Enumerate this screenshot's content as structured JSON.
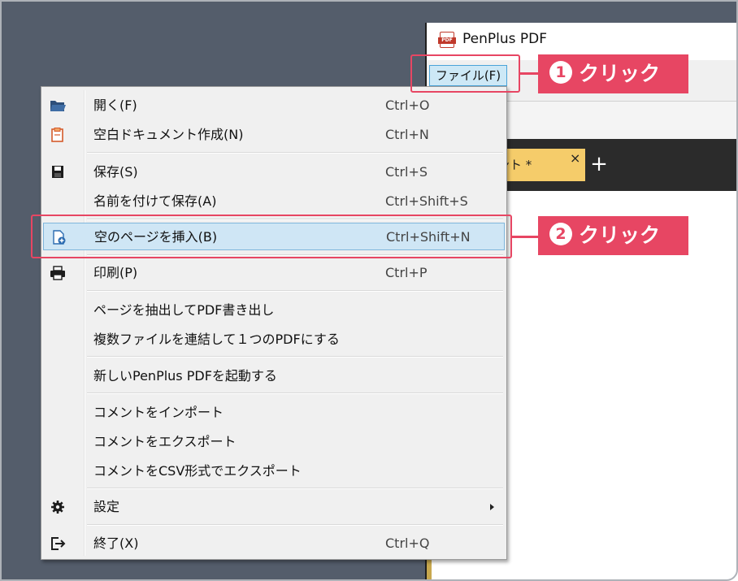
{
  "window": {
    "title": "PenPlus PDF",
    "icon": "pdf-app-icon",
    "icon_text": "PDF"
  },
  "menubar": {
    "file_label": "ファイル(F)"
  },
  "tabs": [
    {
      "label": "メント *",
      "close": "×"
    }
  ],
  "tab_add": "+",
  "file_menu": {
    "items": [
      {
        "icon": "folder-open-icon",
        "label": "開く(F)",
        "shortcut": "Ctrl+O"
      },
      {
        "icon": "new-document-icon",
        "label": "空白ドキュメント作成(N)",
        "shortcut": "Ctrl+N"
      },
      {
        "icon": "save-icon",
        "label": "保存(S)",
        "shortcut": "Ctrl+S"
      },
      {
        "icon": "",
        "label": "名前を付けて保存(A)",
        "shortcut": "Ctrl+Shift+S"
      },
      {
        "icon": "insert-page-icon",
        "label": "空のページを挿入(B)",
        "shortcut": "Ctrl+Shift+N"
      },
      {
        "icon": "printer-icon",
        "label": "印刷(P)",
        "shortcut": "Ctrl+P"
      },
      {
        "icon": "",
        "label": "ページを抽出してPDF書き出し",
        "shortcut": ""
      },
      {
        "icon": "",
        "label": "複数ファイルを連結して１つのPDFにする",
        "shortcut": ""
      },
      {
        "icon": "",
        "label": "新しいPenPlus PDFを起動する",
        "shortcut": ""
      },
      {
        "icon": "",
        "label": "コメントをインポート",
        "shortcut": ""
      },
      {
        "icon": "",
        "label": "コメントをエクスポート",
        "shortcut": ""
      },
      {
        "icon": "",
        "label": "コメントをCSV形式でエクスポート",
        "shortcut": ""
      },
      {
        "icon": "gear-icon",
        "label": "設定",
        "shortcut": ""
      },
      {
        "icon": "exit-icon",
        "label": "終了(X)",
        "shortcut": "Ctrl+Q"
      }
    ]
  },
  "annotations": [
    {
      "number": "1",
      "text": "クリック"
    },
    {
      "number": "2",
      "text": "クリック"
    }
  ],
  "colors": {
    "annotation": "#e74663",
    "highlight": "#cfe6f5",
    "tab": "#f5cc6a",
    "desktop": "#545d6b"
  }
}
